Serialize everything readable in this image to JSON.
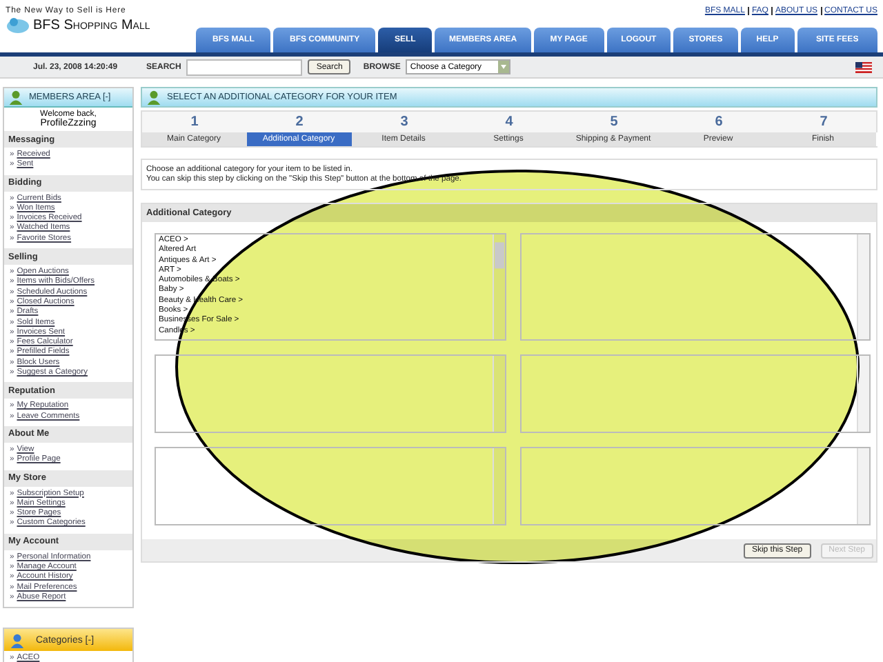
{
  "header": {
    "tagline": "The New Way to Sell is Here",
    "logo": "BFS Shopping Mall",
    "top_links": [
      "BFS MALL",
      "FAQ",
      "ABOUT US",
      "CONTACT US"
    ],
    "nav_tabs": [
      {
        "label": "BFS MALL",
        "selected": false
      },
      {
        "label": "BFS COMMUNITY",
        "selected": false
      },
      {
        "label": "SELL",
        "selected": true
      },
      {
        "label": "MEMBERS AREA",
        "selected": false
      },
      {
        "label": "MY PAGE",
        "selected": false
      },
      {
        "label": "LOGOUT",
        "selected": false
      },
      {
        "label": "STORES",
        "selected": false
      },
      {
        "label": "HELP",
        "selected": false
      },
      {
        "label": "SITE FEES",
        "selected": false
      }
    ]
  },
  "toolbar": {
    "datetime": "Jul. 23, 2008 14:20:49",
    "search_label": "SEARCH",
    "search_button": "Search",
    "browse_label": "BROWSE",
    "browse_value": "Choose a Category"
  },
  "sidebar": {
    "title": "MEMBERS AREA [-]",
    "welcome": "Welcome back,",
    "username": "ProfileZzzing",
    "bullet": "»",
    "sections": [
      {
        "title": "Messaging",
        "links": [
          "Received",
          "Sent"
        ]
      },
      {
        "title": "Bidding",
        "links": [
          "Current Bids",
          "Won Items",
          "Invoices Received",
          "Watched Items",
          "Favorite Stores"
        ]
      },
      {
        "title": "Selling",
        "links": [
          "Open Auctions",
          "Items with Bids/Offers",
          "Scheduled Auctions",
          "Closed Auctions",
          "Drafts",
          "Sold Items",
          "Invoices Sent",
          "Fees Calculator",
          "Prefilled Fields",
          "Block Users",
          "Suggest a Category"
        ]
      },
      {
        "title": "Reputation",
        "links": [
          "My Reputation",
          "Leave Comments"
        ]
      },
      {
        "title": "About Me",
        "links": [
          "View",
          "Profile Page"
        ]
      },
      {
        "title": "My Store",
        "links": [
          "Subscription Setup",
          "Main Settings",
          "Store Pages",
          "Custom Categories"
        ]
      },
      {
        "title": "My Account",
        "links": [
          "Personal Information",
          "Manage Account",
          "Account History",
          "Mail Preferences",
          "Abuse Report"
        ]
      }
    ]
  },
  "categories_box": {
    "title": "Categories [-]",
    "bullet": "»",
    "items": [
      "ACEO"
    ]
  },
  "main": {
    "title": "SELECT AN ADDITIONAL CATEGORY FOR YOUR ITEM",
    "steps": [
      {
        "number": "1",
        "label": "Main Category",
        "selected": false
      },
      {
        "number": "2",
        "label": "Additional Category",
        "selected": true
      },
      {
        "number": "3",
        "label": "Item Details",
        "selected": false
      },
      {
        "number": "4",
        "label": "Settings",
        "selected": false
      },
      {
        "number": "5",
        "label": "Shipping & Payment",
        "selected": false
      },
      {
        "number": "6",
        "label": "Preview",
        "selected": false
      },
      {
        "number": "7",
        "label": "Finish",
        "selected": false
      }
    ],
    "instructions": [
      "Choose an additional category for your item to be listed in.",
      "You can skip this step by clicking on the \"Skip this Step\" button at the bottom of the page."
    ],
    "panel_title": "Additional Category",
    "category_lists": [
      {
        "kind": "filled",
        "items": [
          "ACEO >",
          "Altered Art",
          "Antiques & Art >",
          "ART >",
          "Automobiles & Boats >",
          "Baby >",
          "Beauty & Health Care >",
          "Books >",
          "Businesses For Sale >",
          "Candles >"
        ]
      },
      {
        "kind": "empty"
      },
      {
        "kind": "empty"
      },
      {
        "kind": "empty"
      },
      {
        "kind": "empty"
      },
      {
        "kind": "empty"
      }
    ],
    "buttons": [
      {
        "label": "Skip this Step",
        "disabled": false
      },
      {
        "label": "Next Step",
        "disabled": true
      }
    ]
  },
  "annotation": {
    "kind": "ellipse"
  }
}
